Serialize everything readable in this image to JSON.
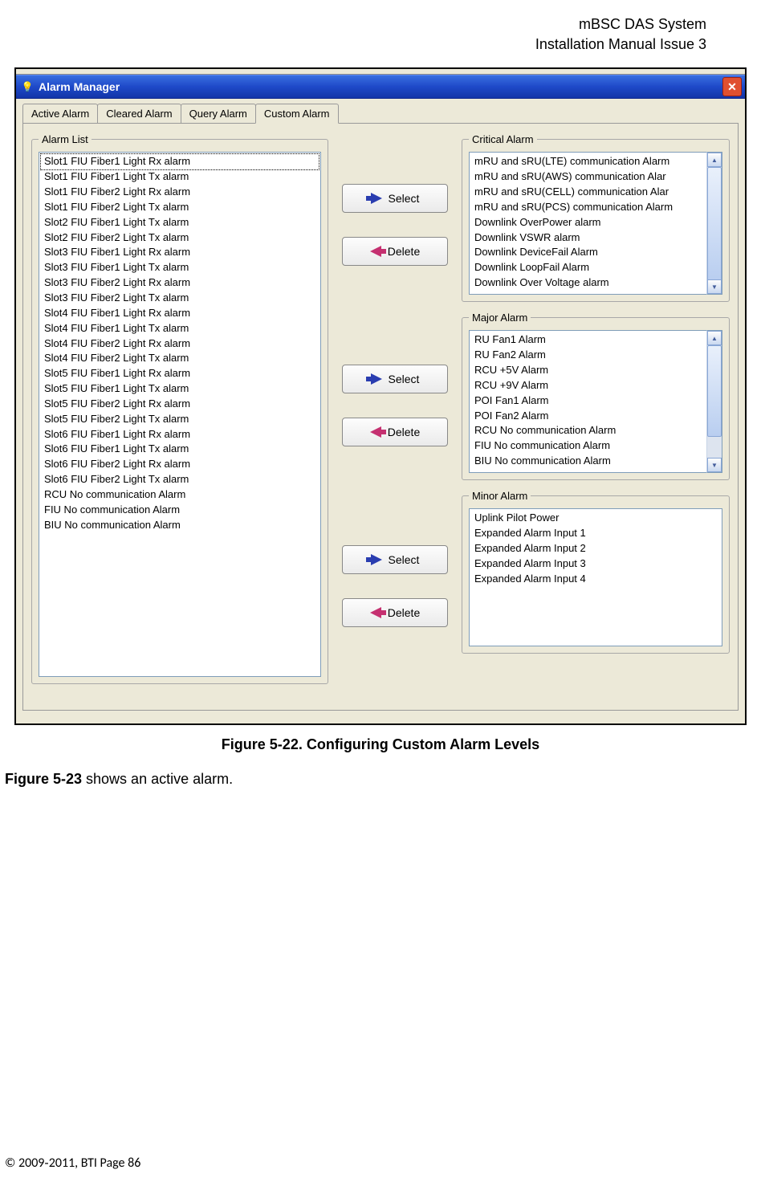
{
  "header": {
    "line1": "mBSC DAS System",
    "line2": "Installation Manual Issue 3"
  },
  "window": {
    "title": "Alarm Manager",
    "icon_name": "bulb-icon"
  },
  "tabs": [
    {
      "label": "Active Alarm",
      "active": false
    },
    {
      "label": "Cleared Alarm",
      "active": false
    },
    {
      "label": "Query Alarm",
      "active": false
    },
    {
      "label": "Custom Alarm",
      "active": true
    }
  ],
  "groups": {
    "alarm_list": {
      "legend": "Alarm List",
      "items": [
        "Slot1 FIU Fiber1 Light Rx alarm",
        "Slot1 FIU Fiber1 Light Tx alarm",
        "Slot1 FIU Fiber2 Light Rx alarm",
        "Slot1 FIU Fiber2 Light Tx alarm",
        "Slot2 FIU Fiber1 Light Tx alarm",
        "Slot2 FIU Fiber2 Light Tx alarm",
        "Slot3 FIU Fiber1 Light Rx alarm",
        "Slot3 FIU Fiber1 Light Tx alarm",
        "Slot3 FIU Fiber2 Light Rx alarm",
        "Slot3 FIU Fiber2 Light Tx alarm",
        "Slot4 FIU Fiber1 Light Rx alarm",
        "Slot4 FIU Fiber1 Light Tx alarm",
        "Slot4 FIU Fiber2 Light Rx alarm",
        "Slot4 FIU Fiber2 Light Tx alarm",
        "Slot5 FIU Fiber1 Light Rx alarm",
        "Slot5 FIU Fiber1 Light Tx alarm",
        "Slot5 FIU Fiber2 Light Rx alarm",
        "Slot5 FIU Fiber2 Light Tx alarm",
        "Slot6 FIU Fiber1 Light Rx alarm",
        "Slot6 FIU Fiber1 Light Tx alarm",
        "Slot6 FIU Fiber2 Light Rx alarm",
        "Slot6 FIU Fiber2 Light Tx alarm",
        "RCU No communication Alarm",
        "FIU No communication Alarm",
        "BIU No communication Alarm"
      ],
      "selected_index": 0
    },
    "critical": {
      "legend": "Critical Alarm",
      "items": [
        "mRU and sRU(LTE) communication Alarm",
        "mRU and sRU(AWS) communication Alar",
        "mRU and sRU(CELL) communication Alar",
        "mRU and sRU(PCS) communication Alarm",
        "Downlink OverPower alarm",
        "Downlink VSWR alarm",
        "Downlink DeviceFail Alarm",
        "Downlink LoopFail Alarm",
        "Downlink Over Voltage alarm"
      ]
    },
    "major": {
      "legend": "Major Alarm",
      "items": [
        "RU Fan1 Alarm",
        "RU Fan2 Alarm",
        "RCU +5V Alarm",
        "RCU +9V Alarm",
        "POI Fan1 Alarm",
        "POI Fan2 Alarm",
        "RCU No communication Alarm",
        "FIU No communication Alarm",
        "BIU No communication Alarm"
      ]
    },
    "minor": {
      "legend": "Minor Alarm",
      "items": [
        "Uplink Pilot Power",
        "Expanded Alarm Input 1",
        "Expanded Alarm Input 2",
        "Expanded Alarm Input 3",
        "Expanded Alarm Input 4"
      ]
    }
  },
  "buttons": {
    "select": "Select",
    "delete": "Delete"
  },
  "caption": "Figure 5-22. Configuring Custom Alarm Levels",
  "body": {
    "ref": "Figure 5-23",
    "text": " shows an active alarm."
  },
  "footer": "© 2009‐2011, BTI Page 86"
}
